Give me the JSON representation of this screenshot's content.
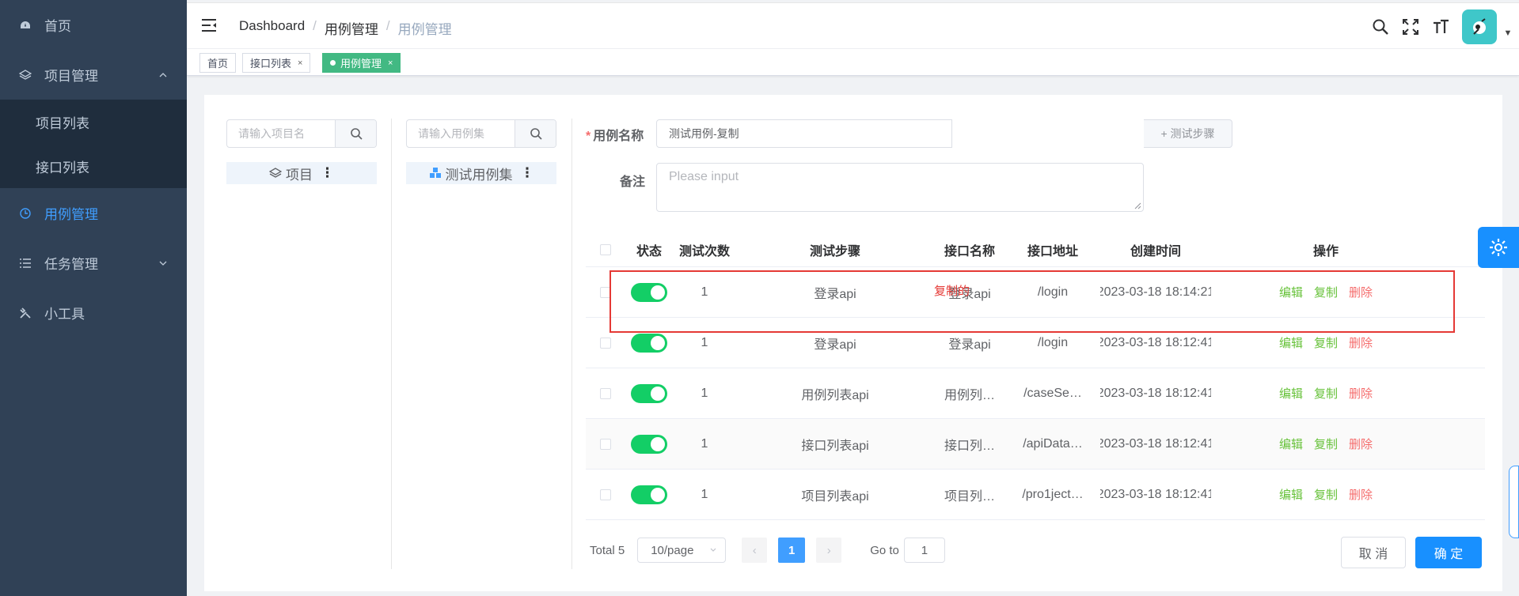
{
  "sidebar": {
    "items": [
      {
        "label": "首页",
        "icon": "dashboard-icon"
      },
      {
        "label": "项目管理",
        "icon": "layers-icon",
        "expanded": true,
        "children": [
          {
            "label": "项目列表"
          },
          {
            "label": "接口列表"
          }
        ]
      },
      {
        "label": "用例管理",
        "icon": "clock-icon",
        "active": true
      },
      {
        "label": "任务管理",
        "icon": "list-icon",
        "expanded": false
      },
      {
        "label": "小工具",
        "icon": "tools-icon"
      }
    ]
  },
  "navbar": {
    "breadcrumb": [
      "Dashboard",
      "用例管理",
      "用例管理"
    ],
    "separator": "/"
  },
  "tags": [
    {
      "label": "首页",
      "closable": false
    },
    {
      "label": "接口列表",
      "closable": true
    },
    {
      "label": "用例管理",
      "closable": true,
      "active": true
    }
  ],
  "left_panel": {
    "project_search_placeholder": "请输入项目名",
    "project_node": "项目",
    "case_search_placeholder": "请输入用例集",
    "case_node": "测试用例集"
  },
  "form": {
    "name_label": "用例名称",
    "name_value": "测试用例-复制",
    "steps_button": "+ 测试步骤",
    "remark_label": "备注",
    "remark_placeholder": "Please input"
  },
  "table": {
    "headers": [
      "状态",
      "测试次数",
      "测试步骤",
      "接口名称",
      "接口地址",
      "创建时间",
      "操作"
    ],
    "rows": [
      {
        "count": "1",
        "steps": "登录api",
        "api_name": "登录api",
        "api_path": "/login",
        "created": "2023-03-18 18:14:21"
      },
      {
        "count": "1",
        "steps": "登录api",
        "api_name": "登录api",
        "api_path": "/login",
        "created": "2023-03-18 18:12:41"
      },
      {
        "count": "1",
        "steps": "用例列表api",
        "api_name": "用例列…",
        "api_path": "/caseSe…",
        "created": "2023-03-18 18:12:41"
      },
      {
        "count": "1",
        "steps": "接口列表api",
        "api_name": "接口列…",
        "api_path": "/apiData…",
        "created": "2023-03-18 18:12:41"
      },
      {
        "count": "1",
        "steps": "项目列表api",
        "api_name": "项目列…",
        "api_path": "/pro1ject…",
        "created": "2023-03-18 18:12:41"
      }
    ],
    "ops": {
      "edit": "编辑",
      "copy": "复制",
      "delete": "删除"
    }
  },
  "annotation": {
    "text": "复制的",
    "color": "#e53935"
  },
  "pagination": {
    "total": "Total 5",
    "page_size": "10/page",
    "current_page": "1",
    "goto_label": "Go to",
    "goto_value": "1"
  },
  "actions": {
    "cancel": "取 消",
    "confirm": "确 定"
  },
  "colors": {
    "sidebar_bg": "#304156",
    "accent": "#409eff",
    "switch_on": "#13ce66",
    "tag_active": "#42b983",
    "danger": "#f56c6c"
  }
}
